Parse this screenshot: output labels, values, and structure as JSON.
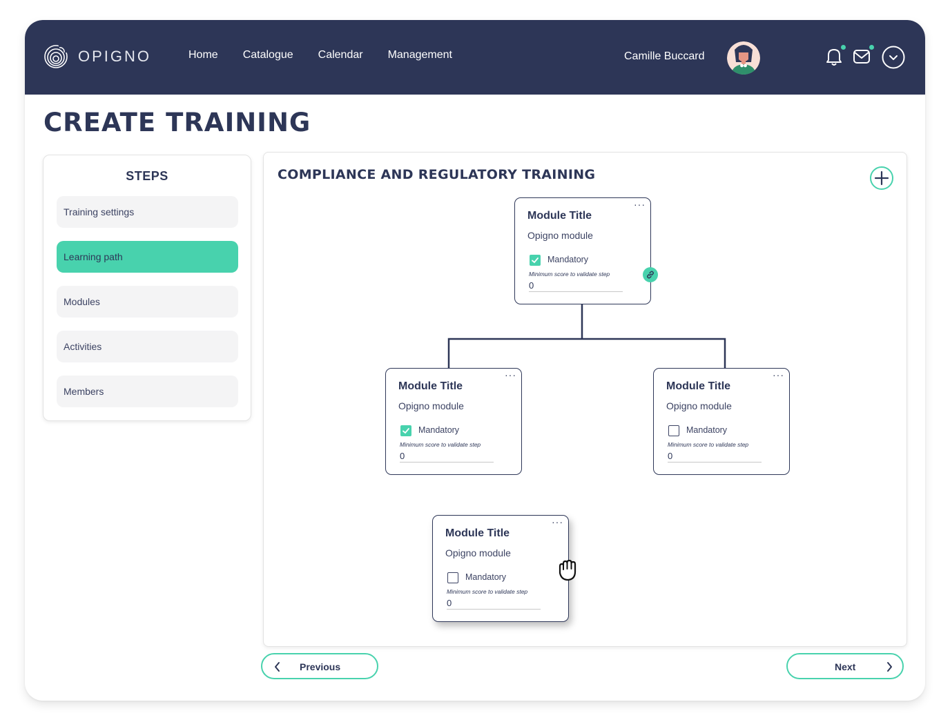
{
  "header": {
    "brand": "OPIGNO",
    "nav": [
      {
        "label": "Home"
      },
      {
        "label": "Catalogue"
      },
      {
        "label": "Calendar"
      },
      {
        "label": "Management"
      }
    ],
    "user_name": "Camille Buccard",
    "icons": [
      "bell-icon",
      "mail-icon",
      "chevron-down-circle-icon"
    ],
    "notification_dot_color": "#48d2ad"
  },
  "page": {
    "title": "CREATE TRAINING"
  },
  "steps": {
    "title": "STEPS",
    "items": [
      {
        "label": "Training settings",
        "active": false
      },
      {
        "label": "Learning path",
        "active": true
      },
      {
        "label": "Modules",
        "active": false
      },
      {
        "label": "Activities",
        "active": false
      },
      {
        "label": "Members",
        "active": false
      }
    ]
  },
  "learning_path": {
    "title": "COMPLIANCE AND REGULATORY TRAINING",
    "add_button_icon": "plus-icon",
    "modules": [
      {
        "title": "Module Title",
        "subtitle": "Opigno module",
        "mandatory_label": "Mandatory",
        "mandatory": true,
        "min_score_label": "Minimum score to validate step",
        "min_score": "0"
      },
      {
        "title": "Module Title",
        "subtitle": "Opigno module",
        "mandatory_label": "Mandatory",
        "mandatory": true,
        "min_score_label": "Minimum score to validate step",
        "min_score": "0"
      },
      {
        "title": "Module Title",
        "subtitle": "Opigno module",
        "mandatory_label": "Mandatory",
        "mandatory": false,
        "min_score_label": "Minimum score to validate step",
        "min_score": "0"
      },
      {
        "title": "Module Title",
        "subtitle": "Opigno module",
        "mandatory_label": "Mandatory",
        "mandatory": false,
        "min_score_label": "Minimum score to validate step",
        "min_score": "0"
      }
    ],
    "more_label": "···"
  },
  "footer": {
    "previous_label": "Previous",
    "next_label": "Next"
  },
  "colors": {
    "primary": "#2d3657",
    "accent": "#48d2ad",
    "step_bg": "#f4f4f5"
  }
}
